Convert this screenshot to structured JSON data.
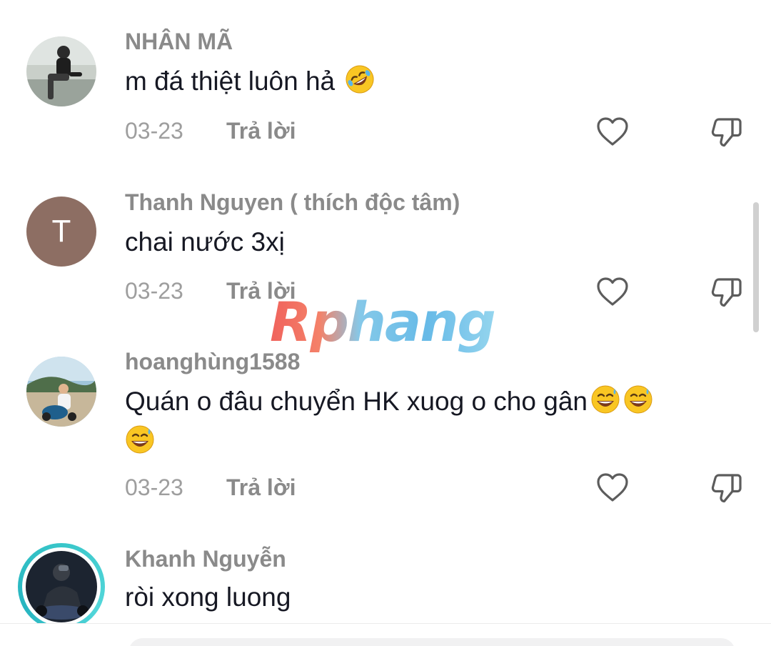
{
  "comments": [
    {
      "username": "NHÂN MÃ",
      "text": "m đá thiệt luôn hả",
      "emoji": [
        "rolling-on-floor-laughing"
      ],
      "date": "03-23",
      "reply_label": "Trả lời"
    },
    {
      "username": "Thanh Nguyen ( thích độc tâm)",
      "avatar_letter": "T",
      "text": "chai nước 3xị",
      "date": "03-23",
      "reply_label": "Trả lời"
    },
    {
      "username": "hoanghùng1588",
      "text": "Quán o đâu chuyển HK xuog o cho gân",
      "emoji": [
        "grinning-face-with-sweat",
        "grinning-face-with-sweat",
        "grinning-face-with-sweat"
      ],
      "date": "03-23",
      "reply_label": "Trả lời"
    },
    {
      "username": "Khanh Nguyễn",
      "text": "ròi xong luong"
    }
  ],
  "watermark": {
    "text": "Rphang"
  },
  "icons": {
    "like": "heart-outline-icon",
    "dislike": "thumbs-down-outline-icon"
  },
  "colors": {
    "username": "#8a8a8a",
    "text": "#161823",
    "meta": "#9e9e9e",
    "story_ring": "#38c6c9",
    "avatar_letter_bg": "#8d6e63"
  }
}
